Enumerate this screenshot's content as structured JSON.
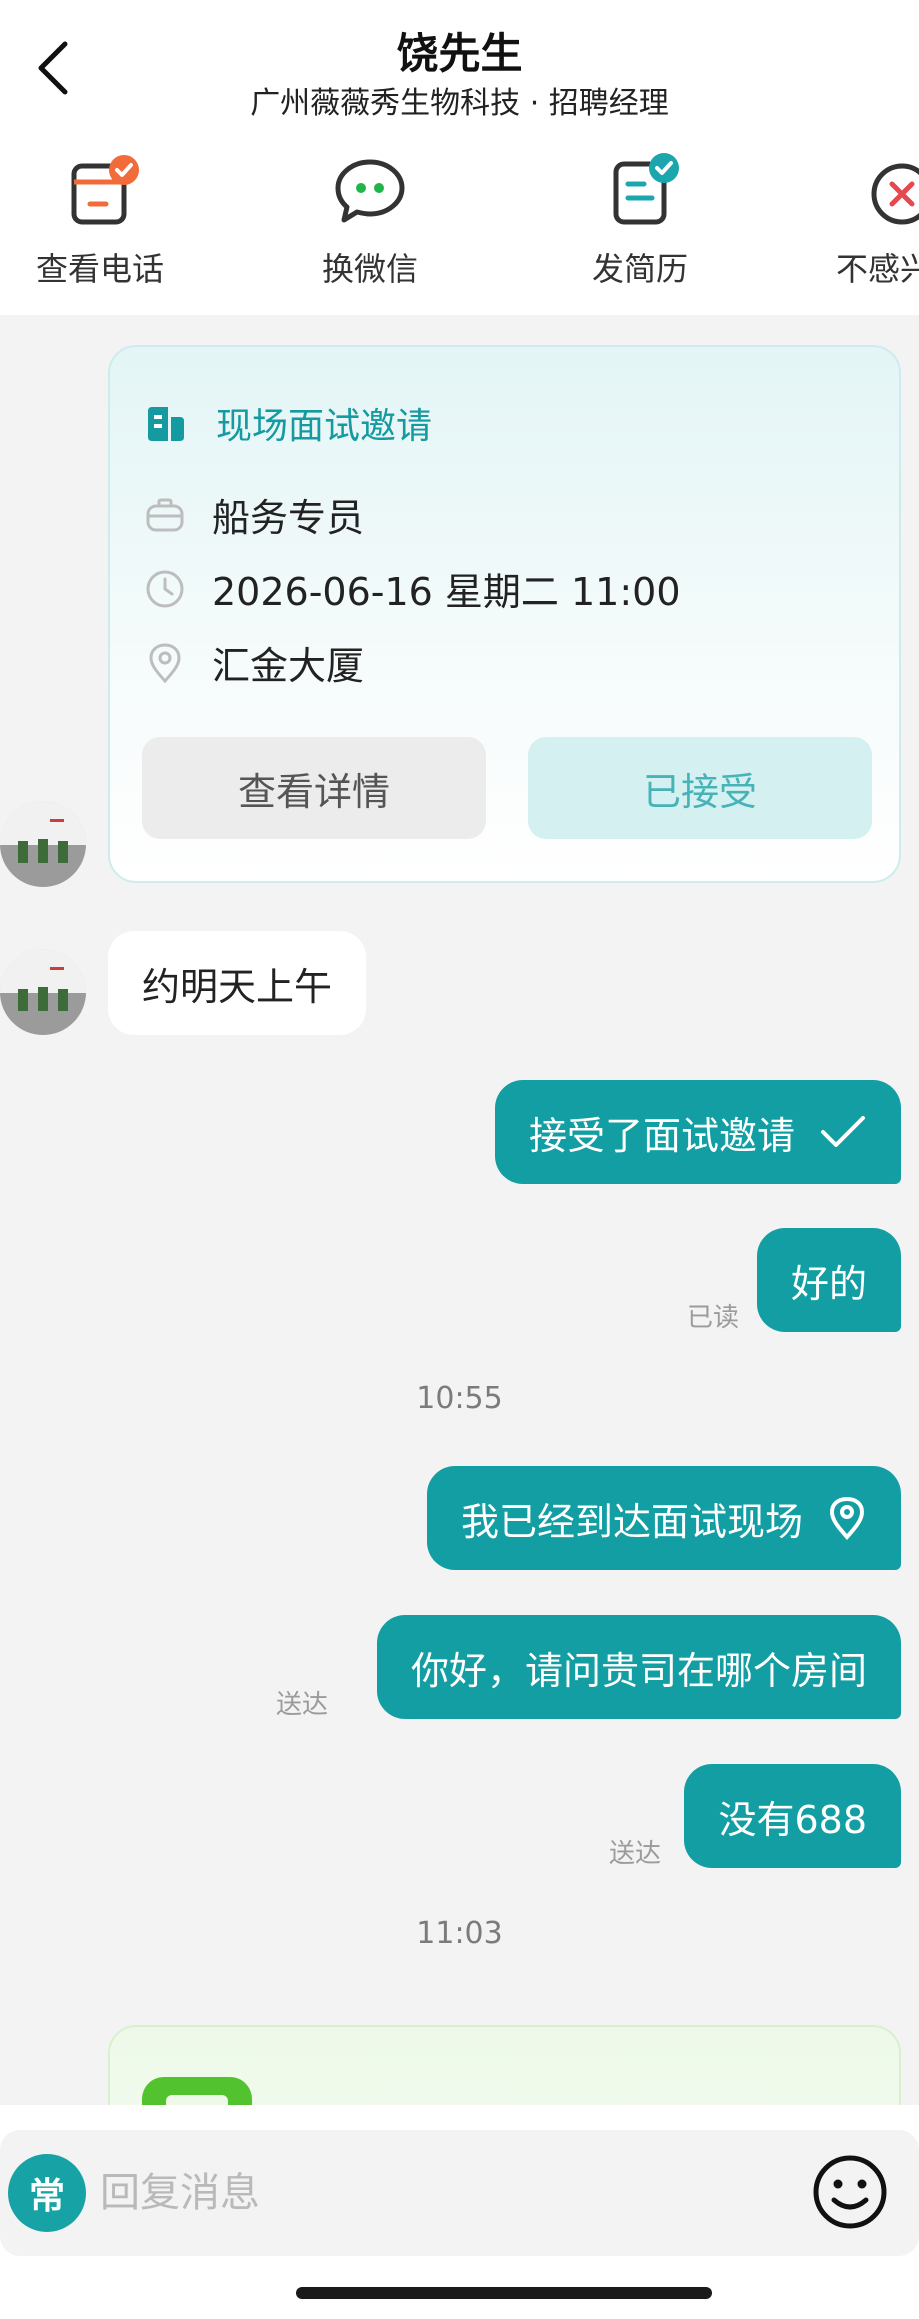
{
  "header": {
    "title": "饶先生",
    "subtitle": "广州薇薇秀生物科技 · 招聘经理"
  },
  "actions": [
    {
      "label": "查看电话",
      "icon": "phone-card-icon"
    },
    {
      "label": "换微信",
      "icon": "wechat-icon"
    },
    {
      "label": "发简历",
      "icon": "resume-icon"
    },
    {
      "label": "不感兴趣",
      "icon": "not-interested-icon"
    }
  ],
  "invite": {
    "title": "现场面试邀请",
    "position": "船务专员",
    "time": "2026-06-16 星期二 11:00",
    "location": "汇金大厦",
    "detail_button": "查看详情",
    "accepted_button": "已接受"
  },
  "messages": {
    "in_1": "约明天上午",
    "out_accept": "接受了面试邀请",
    "out_ok": "好的",
    "status_read": "已读",
    "time_1": "10:55",
    "out_arrived": "我已经到达面试现场",
    "out_room": "你好，请问贵司在哪个房间",
    "status_sent_1": "送达",
    "out_none": "没有688",
    "status_sent_2": "送达",
    "time_2": "11:03"
  },
  "input": {
    "quick_label": "常",
    "placeholder": "回复消息"
  },
  "colors": {
    "accent": "#129ea2",
    "accent_text": "#149aa0",
    "badge_orange": "#f26b3a",
    "badge_teal": "#1aa6ad",
    "badge_red": "#e5484d"
  }
}
